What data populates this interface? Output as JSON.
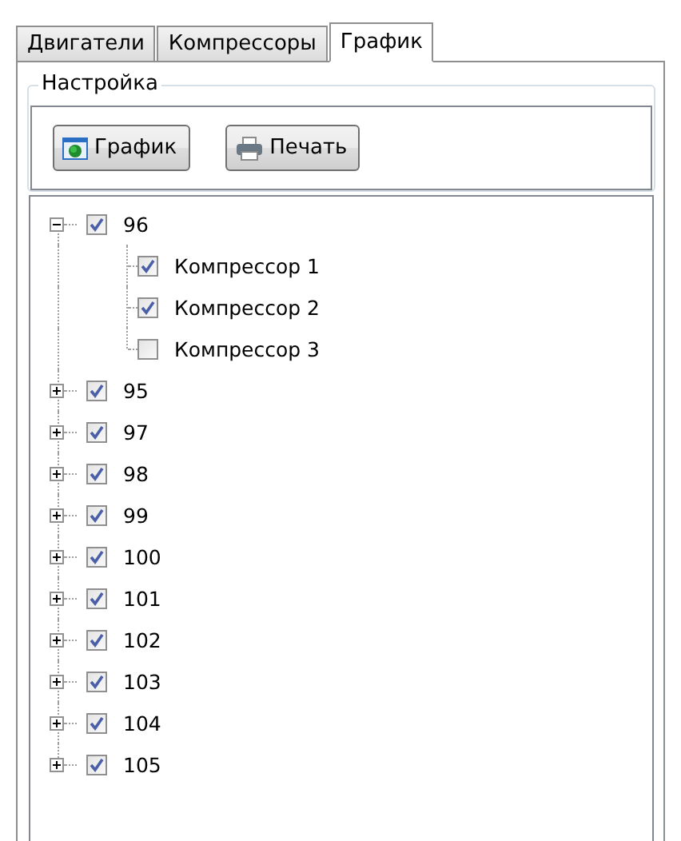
{
  "tabs": [
    {
      "label": "Двигатели",
      "selected": false
    },
    {
      "label": "Компрессоры",
      "selected": false
    },
    {
      "label": "График",
      "selected": true
    }
  ],
  "settings_group": {
    "title": "Настройка",
    "buttons": [
      {
        "label": "График",
        "kind": "chart"
      },
      {
        "label": "Печать",
        "kind": "print"
      }
    ]
  },
  "tree": [
    {
      "label": "96",
      "checked": true,
      "expanded": true,
      "children": [
        {
          "label": "Компрессор 1",
          "checked": true
        },
        {
          "label": "Компрессор 2",
          "checked": true
        },
        {
          "label": "Компрессор 3",
          "checked": false
        }
      ]
    },
    {
      "label": "95",
      "checked": true,
      "expanded": false
    },
    {
      "label": "97",
      "checked": true,
      "expanded": false
    },
    {
      "label": "98",
      "checked": true,
      "expanded": false
    },
    {
      "label": "99",
      "checked": true,
      "expanded": false
    },
    {
      "label": "100",
      "checked": true,
      "expanded": false
    },
    {
      "label": "101",
      "checked": true,
      "expanded": false
    },
    {
      "label": "102",
      "checked": true,
      "expanded": false
    },
    {
      "label": "103",
      "checked": true,
      "expanded": false
    },
    {
      "label": "104",
      "checked": true,
      "expanded": false
    },
    {
      "label": "105",
      "checked": true,
      "expanded": false
    }
  ]
}
